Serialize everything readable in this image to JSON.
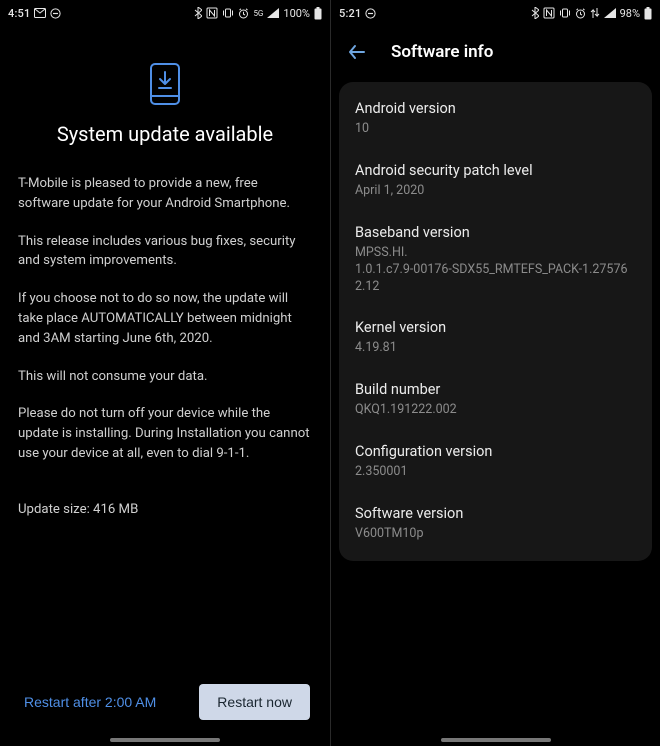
{
  "left": {
    "status": {
      "time": "4:51",
      "battery": "100%"
    },
    "title": "System update available",
    "paragraphs": [
      "T-Mobile is pleased to provide a new, free software update for your Android Smartphone.",
      "This release includes various bug fixes, security and system improvements.",
      "If you choose not to do so now, the update will take place AUTOMATICALLY between midnight and 3AM starting June 6th, 2020.",
      "This will not consume your data.",
      "Please do not turn off your device while the update is installing. During Installation you cannot use your device at all, even to dial 9-1-1."
    ],
    "size_line": "Update size: 416 MB",
    "restart_after_label": "Restart after 2:00 AM",
    "restart_now_label": "Restart now"
  },
  "right": {
    "status": {
      "time": "5:21",
      "battery": "98%"
    },
    "header_title": "Software info",
    "rows": [
      {
        "label": "Android version",
        "value": "10"
      },
      {
        "label": "Android security patch level",
        "value": "April 1, 2020"
      },
      {
        "label": "Baseband version",
        "value": "MPSS.HI.\n1.0.1.c7.9-00176-SDX55_RMTEFS_PACK-1.275762.12"
      },
      {
        "label": "Kernel version",
        "value": "4.19.81"
      },
      {
        "label": "Build number",
        "value": "QKQ1.191222.002"
      },
      {
        "label": "Configuration version",
        "value": "2.350001"
      },
      {
        "label": "Software version",
        "value": "V600TM10p"
      }
    ]
  }
}
